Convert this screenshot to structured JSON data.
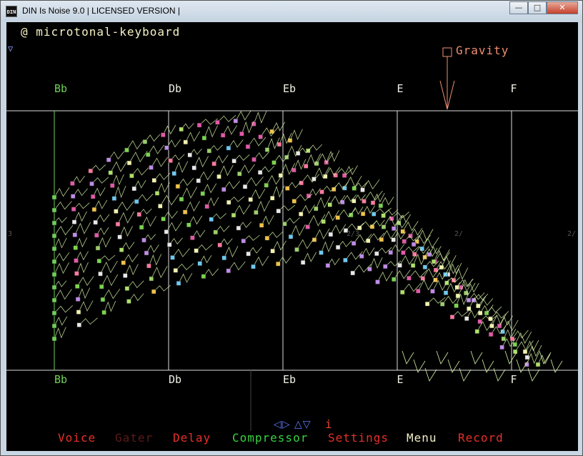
{
  "window": {
    "title": "DIN Is Noise 9.0 | LICENSED VERSION |",
    "icon_text": "DIN",
    "buttons": {
      "minimize": "—",
      "maximize": "□",
      "close": "✕"
    }
  },
  "header": {
    "mode_label": "@ microtonal-keyboard",
    "gravity_label": "Gravity",
    "collapse_marker": "▽"
  },
  "notes_top": [
    "Bb",
    "Db",
    "Eb",
    "E",
    "F"
  ],
  "notes_bottom": [
    "Bb",
    "Db",
    "Eb",
    "E",
    "F"
  ],
  "ratios": [
    "3",
    "2/3",
    "2/",
    "2/"
  ],
  "nav": {
    "arrows": "◁▷ △▽",
    "info": "i"
  },
  "menu": [
    {
      "label": "Voice",
      "color": "#e8302a"
    },
    {
      "label": "Gater",
      "color": "#5c1a18"
    },
    {
      "label": "Delay",
      "color": "#e8302a"
    },
    {
      "label": "Compressor",
      "color": "#38d23f"
    },
    {
      "label": "Settings",
      "color": "#e8302a"
    },
    {
      "label": "Menu",
      "color": "#f4efc6"
    },
    {
      "label": "Record",
      "color": "#e8302a"
    }
  ],
  "colors": {
    "background": "#000000",
    "grid_line": "#dcdcdc",
    "active_note": "#6fd058",
    "note_label": "#f0f0e6",
    "gravity": "#ef8f72",
    "drone_trail": "#d8f5a8"
  }
}
